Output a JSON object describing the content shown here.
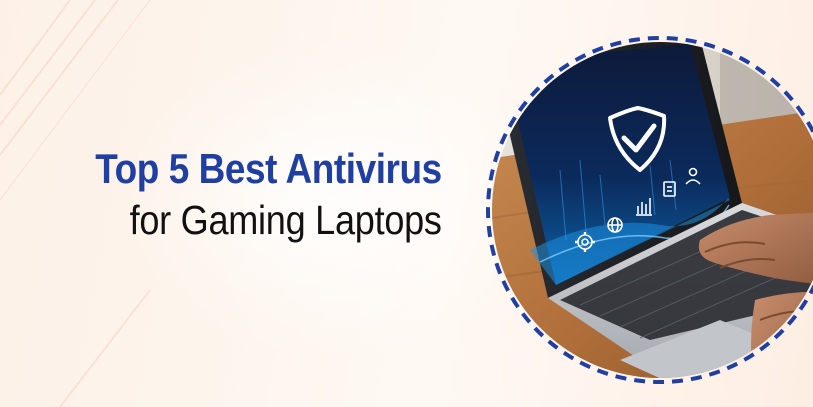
{
  "banner": {
    "title_line1": "Top 5 Best Antivirus",
    "title_line2": "for Gaming Laptops"
  },
  "colors": {
    "accent_blue": "#1f3fa3",
    "text_dark": "#111111",
    "background": "#fdf2e8",
    "dashed_ring": "#1f3fa3"
  },
  "icons": [
    "shield-check-icon",
    "gear-icon",
    "globe-icon",
    "bar-chart-icon",
    "checklist-icon",
    "user-icon"
  ]
}
